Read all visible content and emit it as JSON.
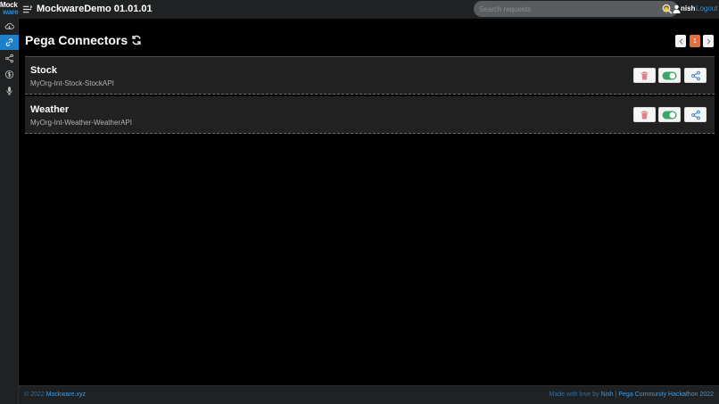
{
  "logo": {
    "line1": "Mock",
    "line2": "ware"
  },
  "sidebar": {
    "items": [
      {
        "icon": "cloud-icon",
        "active": false
      },
      {
        "icon": "link-icon",
        "active": true
      },
      {
        "icon": "share-icon",
        "active": false
      },
      {
        "icon": "dollar-icon",
        "active": false
      },
      {
        "icon": "microphone-icon",
        "active": false
      }
    ]
  },
  "header": {
    "title": "MockwareDemo 01.01.01",
    "search_placeholder": "Search requests",
    "user_name": "nish",
    "logout_label": "Logout"
  },
  "main": {
    "title": "Pega Connectors",
    "pagination": {
      "current_page": "1"
    },
    "connectors": [
      {
        "name": "Stock",
        "ruleset": "MyOrg-Int-Stock-StockAPI",
        "enabled": true
      },
      {
        "name": "Weather",
        "ruleset": "MyOrg-Int-Weather-WeatherAPI",
        "enabled": true
      }
    ]
  },
  "footer": {
    "copyright": "© 2022",
    "site": "Mockware.xyz",
    "made_with": "Made with love by",
    "author": "Nish",
    "separator": "|",
    "event": "Pega Community Hackathon 2022"
  },
  "colors": {
    "accent": "#1d7fc7",
    "link": "#2f8fd6",
    "page_active": "#e07040",
    "delete": "#d9848f",
    "toggle_on": "#3aa66a",
    "share": "#3a7fc4"
  }
}
